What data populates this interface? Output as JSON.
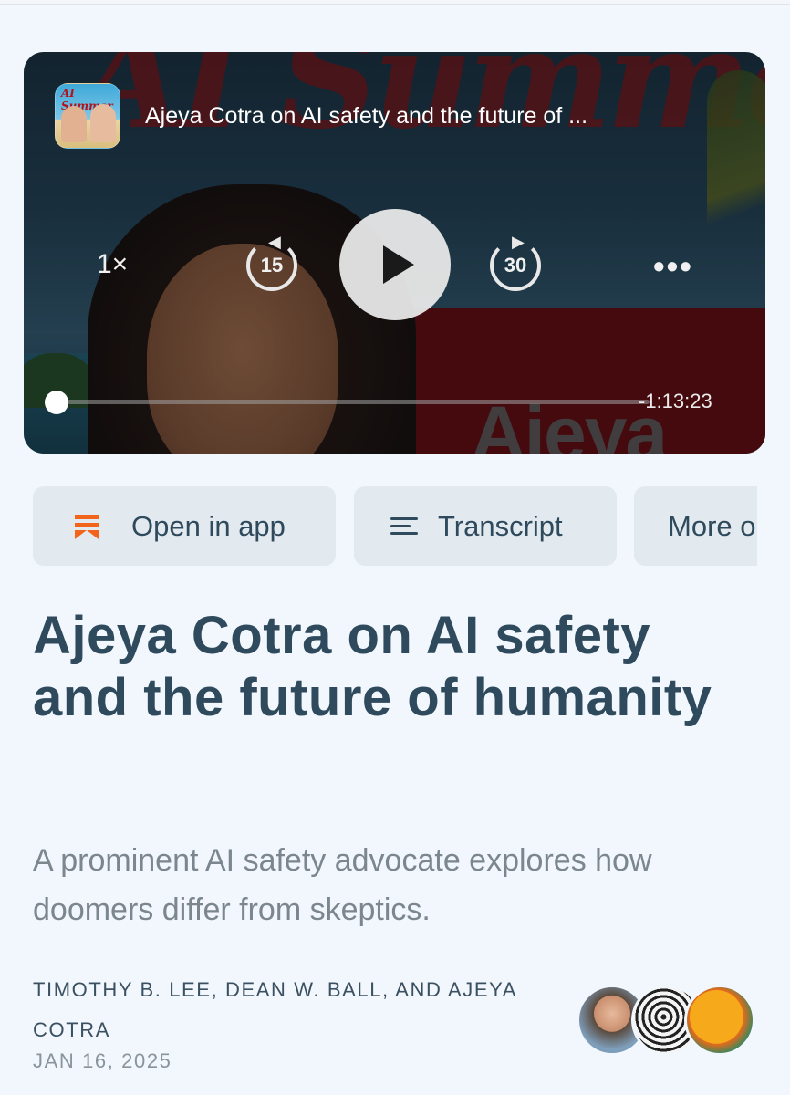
{
  "player": {
    "cover_text": "AI Summer",
    "podcast_thumb_text": "AI Summer",
    "episode_title": "Ajeya Cotra on AI safety and the future of ...",
    "speed": "1×",
    "skip_back": "15",
    "skip_forward": "30",
    "more": "•••",
    "time_remaining": "-1:13:23",
    "overlay_name": "Ajeya",
    "progress_fraction": 0.0
  },
  "actions": {
    "open_in_app": "Open in app",
    "transcript": "Transcript",
    "more": "More o"
  },
  "article": {
    "title": "Ajeya Cotra on AI safety and the future of humanity",
    "subtitle": "A prominent AI safety advocate explores how doomers differ from skeptics.",
    "authors": "TIMOTHY B. LEE, DEAN W. BALL, AND AJEYA COTRA",
    "date": "JAN 16, 2025"
  },
  "icons": {
    "bookmark": "bookmark-icon",
    "transcript": "lines-icon",
    "accent": "#f26419"
  }
}
